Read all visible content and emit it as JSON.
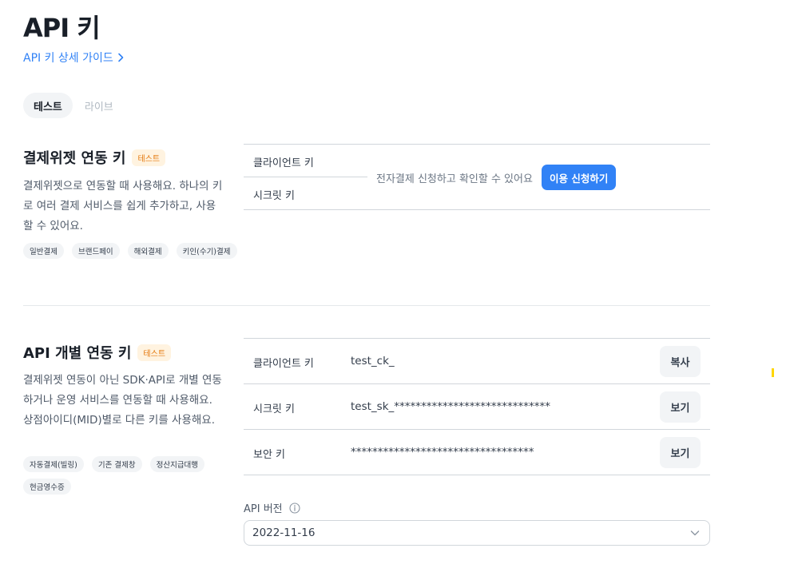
{
  "page": {
    "title": "API 키",
    "guide_link": "API 키 상세 가이드"
  },
  "tabs": [
    {
      "label": "테스트",
      "active": true
    },
    {
      "label": "라이브",
      "active": false
    }
  ],
  "widget_section": {
    "title": "결제위젯 연동 키",
    "badge": "테스트",
    "description": "결제위젯으로 연동할 때 사용해요. 하나의 키로 여러 결제 서비스를 쉽게 추가하고, 사용할 수 있어요.",
    "chips": [
      "일반결제",
      "브랜드페이",
      "해외결제",
      "키인(수기)결제"
    ],
    "client_key_label": "클라이언트 키",
    "secret_key_label": "시크릿 키",
    "notice": "전자결제 신청하고 확인할 수 있어요",
    "apply_button": "이용 신청하기"
  },
  "api_section": {
    "title": "API 개별 연동 키",
    "badge": "테스트",
    "description": "결제위젯 연동이 아닌 SDK·API로 개별 연동하거나 운영 서비스를 연동할 때 사용해요. 상점아이디(MID)별로 다른 키를 사용해요.",
    "chips": [
      "자동결제(빌링)",
      "기존 결제창",
      "정산지급대행",
      "현금영수증"
    ],
    "keys": [
      {
        "label": "클라이언트 키",
        "value": "test_ck_",
        "button": "복사"
      },
      {
        "label": "시크릿 키",
        "value": "test_sk_*****************************",
        "button": "보기"
      },
      {
        "label": "보안 키",
        "value": "**********************************",
        "button": "보기"
      }
    ],
    "version_label": "API 버전",
    "version_value": "2022-11-16"
  },
  "colors": {
    "accent": "#3182f6",
    "badge_text": "#e4780d",
    "badge_bg": "#fff3e0",
    "marker": "#ffd600"
  },
  "icons": [
    "chevron-right-icon",
    "info-icon",
    "chevron-down-icon"
  ]
}
